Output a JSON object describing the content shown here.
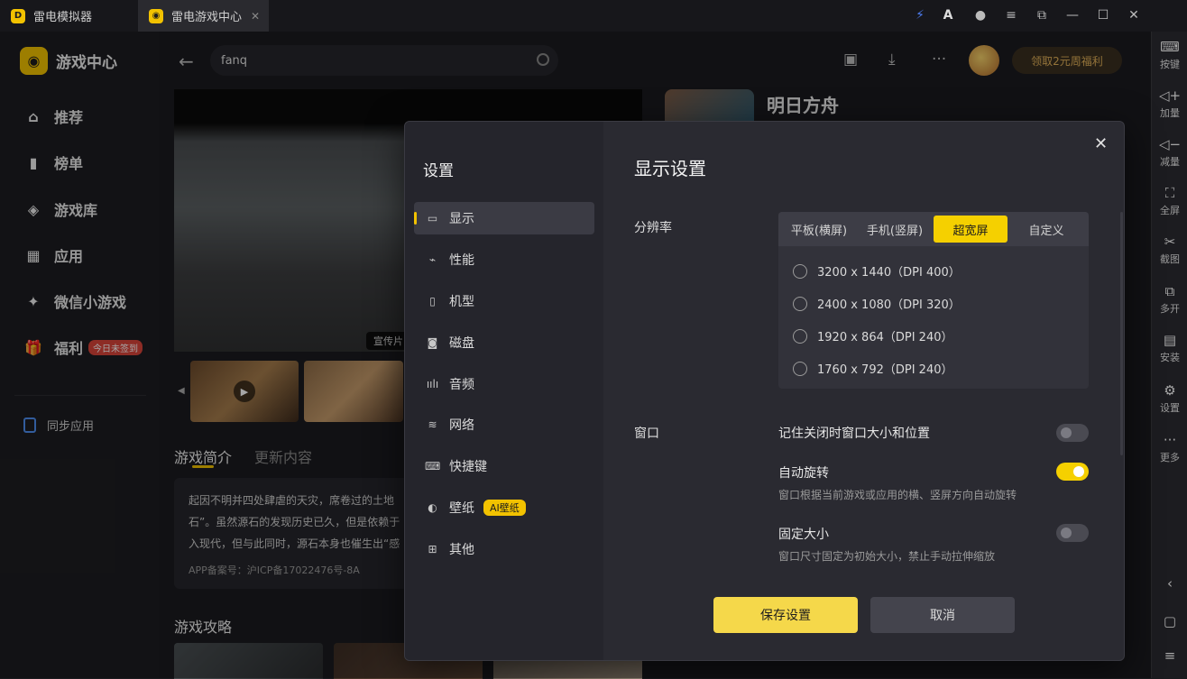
{
  "titlebar": {
    "tabs": [
      {
        "label": "雷电模拟器"
      },
      {
        "label": "雷电游戏中心",
        "close": "✕"
      }
    ]
  },
  "sidebar": {
    "logo_text": "游戏中心",
    "items": [
      {
        "label": "推荐",
        "icon": "home-icon"
      },
      {
        "label": "榜单",
        "icon": "chart-icon"
      },
      {
        "label": "游戏库",
        "icon": "gamepad-icon"
      },
      {
        "label": "应用",
        "icon": "apps-icon"
      },
      {
        "label": "微信小游戏",
        "icon": "wechat-game-icon"
      },
      {
        "label": "福利",
        "icon": "gift-icon",
        "badge": "今日未签到"
      }
    ],
    "sync_label": "同步应用"
  },
  "header": {
    "search_value": "fanq",
    "promo": "领取2元周福利"
  },
  "content": {
    "hero_tag": "宣传片",
    "tab_intro": "游戏简介",
    "tab_update": "更新内容",
    "intro_lines": [
      "起因不明并四处肆虐的天灾，席卷过的土地",
      "石”。虽然源石的发现历史已久，但是依赖于",
      "入现代，但与此同时，源石本身也催生出“感"
    ],
    "icp": "APP备案号：沪ICP备17022476号-8A",
    "guide_title": "游戏攻略",
    "game_title": "明日方舟"
  },
  "right_toolbar": [
    {
      "label": "按键",
      "icon": "keyboard-icon"
    },
    {
      "label": "加量",
      "icon": "volume-up-icon"
    },
    {
      "label": "减量",
      "icon": "volume-down-icon"
    },
    {
      "label": "全屏",
      "icon": "fullscreen-icon"
    },
    {
      "label": "截图",
      "icon": "scissors-icon"
    },
    {
      "label": "多开",
      "icon": "multi-instance-icon"
    },
    {
      "label": "安装",
      "icon": "apk-install-icon"
    },
    {
      "label": "设置",
      "icon": "settings-icon"
    },
    {
      "label": "更多",
      "icon": "more-icon"
    }
  ],
  "modal": {
    "title": "设置",
    "nav": [
      {
        "label": "显示",
        "icon": "monitor-icon"
      },
      {
        "label": "性能",
        "icon": "performance-icon"
      },
      {
        "label": "机型",
        "icon": "phone-icon"
      },
      {
        "label": "磁盘",
        "icon": "disk-icon"
      },
      {
        "label": "音频",
        "icon": "audio-icon"
      },
      {
        "label": "网络",
        "icon": "wifi-icon"
      },
      {
        "label": "快捷键",
        "icon": "keyboard-icon"
      },
      {
        "label": "壁纸",
        "icon": "palette-icon",
        "badge": "AI壁纸"
      },
      {
        "label": "其他",
        "icon": "grid-icon"
      }
    ],
    "section_title": "显示设置",
    "resolution_label": "分辨率",
    "segments": [
      "平板(横屏)",
      "手机(竖屏)",
      "超宽屏",
      "自定义"
    ],
    "selected_segment": "超宽屏",
    "resolutions": [
      "3200 x 1440（DPI 400）",
      "2400 x 1080（DPI 320）",
      "1920 x 864（DPI 240）",
      "1760 x 792（DPI 240）"
    ],
    "window_label": "窗口",
    "options": [
      {
        "title": "记住关闭时窗口大小和位置",
        "desc": "",
        "on": false
      },
      {
        "title": "自动旋转",
        "desc": "窗口根据当前游戏或应用的横、竖屏方向自动旋转",
        "on": true
      },
      {
        "title": "固定大小",
        "desc": "窗口尺寸固定为初始大小，禁止手动拉伸缩放",
        "on": false
      }
    ],
    "save_label": "保存设置",
    "cancel_label": "取消",
    "close": "✕"
  },
  "colors": {
    "accent": "#f5d000",
    "badge_red": "#d9443a"
  }
}
